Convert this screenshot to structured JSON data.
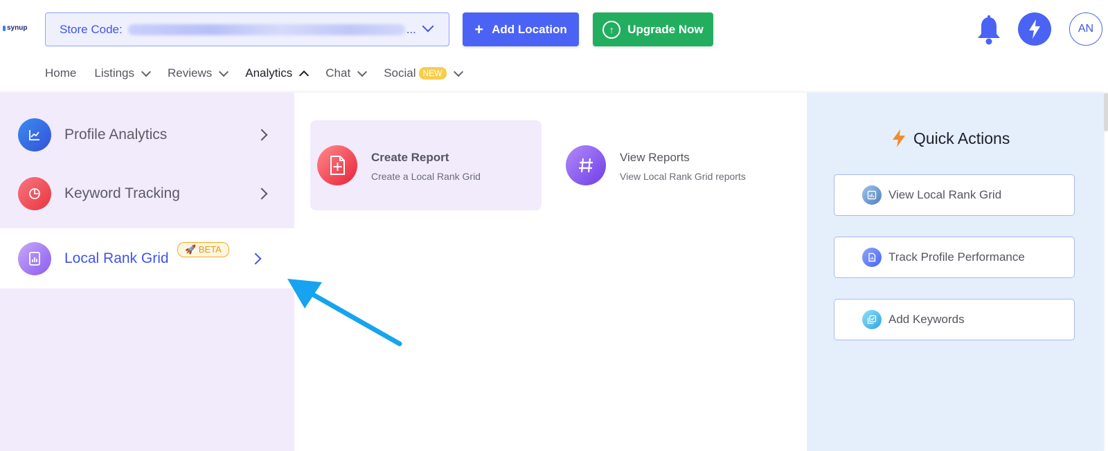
{
  "logo": {
    "text": "synup"
  },
  "store": {
    "label": "Store Code:",
    "ellipsis": "..."
  },
  "header": {
    "add_location": "Add Location",
    "upgrade_now": "Upgrade Now",
    "avatar_initials": "AN",
    "add_location_color": "#4a63f5",
    "upgrade_color": "#23ae5f"
  },
  "nav": {
    "items": [
      {
        "label": "Home"
      },
      {
        "label": "Listings"
      },
      {
        "label": "Reviews"
      },
      {
        "label": "Analytics"
      },
      {
        "label": "Chat"
      },
      {
        "label": "Social",
        "badge": "NEW"
      }
    ]
  },
  "sidebar": {
    "items": [
      {
        "label": "Profile Analytics",
        "icon": "line-chart-icon"
      },
      {
        "label": "Keyword Tracking",
        "icon": "pie-chart-icon"
      },
      {
        "label": "Local Rank Grid",
        "icon": "bar-report-icon",
        "badge": "🚀 BETA",
        "selected": true
      }
    ]
  },
  "cards": [
    {
      "title": "Create Report",
      "subtitle": "Create a Local Rank Grid",
      "icon": "add-document-icon"
    },
    {
      "title": "View Reports",
      "subtitle": "View Local Rank Grid reports",
      "icon": "hash-icon"
    }
  ],
  "quick_actions": {
    "title": "Quick Actions",
    "items": [
      {
        "label": "View Local Rank Grid",
        "icon": "grid-report-icon"
      },
      {
        "label": "Track Profile Performance",
        "icon": "document-chart-icon"
      },
      {
        "label": "Add Keywords",
        "icon": "copy-check-icon"
      }
    ]
  },
  "colors": {
    "accent": "#3e55ea",
    "sidebar_bg": "#f2ebfc",
    "quick_actions_bg": "#e5effc",
    "annotation_arrow": "#17a3ef"
  }
}
